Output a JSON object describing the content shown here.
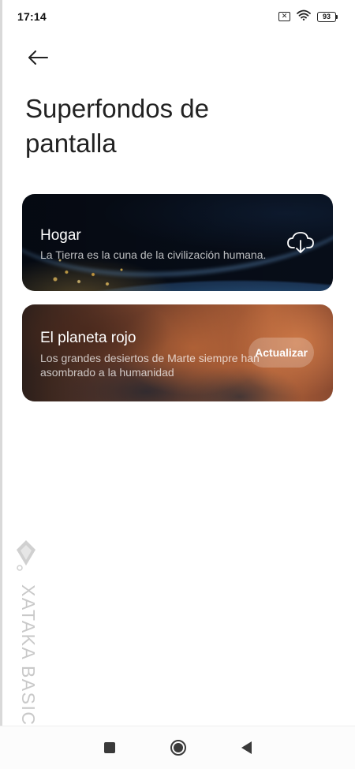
{
  "status_bar": {
    "time": "17:14",
    "sim_icon": "sim-off-icon",
    "wifi_icon": "wifi-icon",
    "battery_level": "93"
  },
  "header": {
    "back_icon": "arrow-left-icon",
    "title": "Superfondos de pantalla"
  },
  "wallpapers": [
    {
      "title": "Hogar",
      "description": "La Tierra es la cuna de la civilización humana.",
      "action_icon": "cloud-download-icon"
    },
    {
      "title": "El planeta rojo",
      "description": "Los grandes desiertos de Marte siempre han asombrado a la humanidad",
      "action_label": "Actualizar"
    }
  ],
  "watermark": {
    "text": "XATAKA BASICS"
  },
  "nav_bar": {
    "recents_icon": "square-icon",
    "home_icon": "circle-home-icon",
    "back_icon": "triangle-back-icon"
  },
  "colors": {
    "background": "#ffffff",
    "text": "#222222",
    "watermark": "#c9c9c9"
  }
}
